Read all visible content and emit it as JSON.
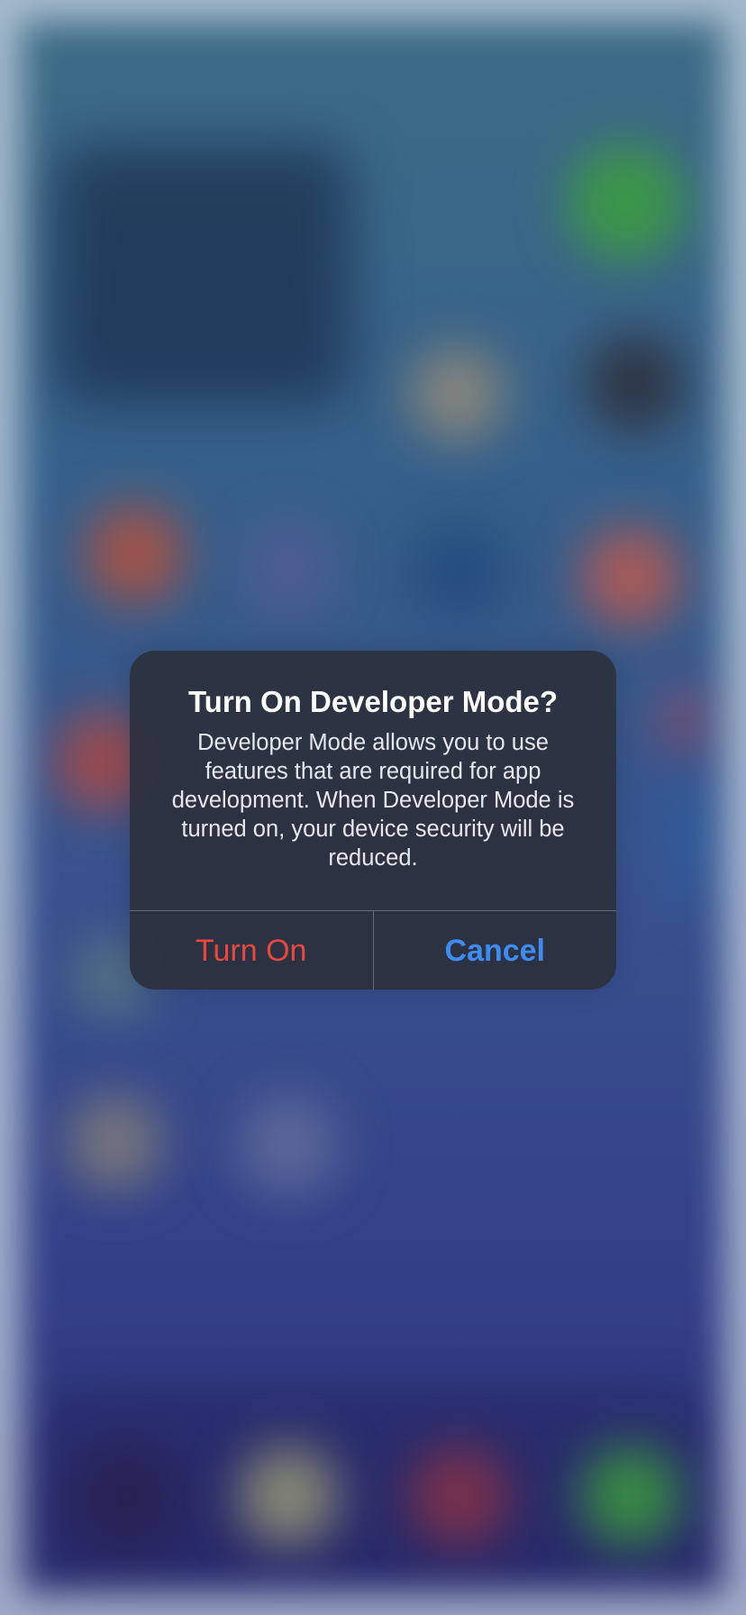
{
  "alert": {
    "title": "Turn On Developer Mode?",
    "message": "Developer Mode allows you to use features that are required for app development. When Developer Mode is turned on, your device security will be reduced.",
    "buttons": [
      {
        "label": "Turn On",
        "role": "destructive",
        "color": "#e8493f"
      },
      {
        "label": "Cancel",
        "role": "cancel",
        "color": "#3f8cf0"
      }
    ]
  },
  "colors": {
    "alert_background": "#2c3240",
    "title_text": "#ffffff",
    "message_text": "#e6e8ee"
  }
}
